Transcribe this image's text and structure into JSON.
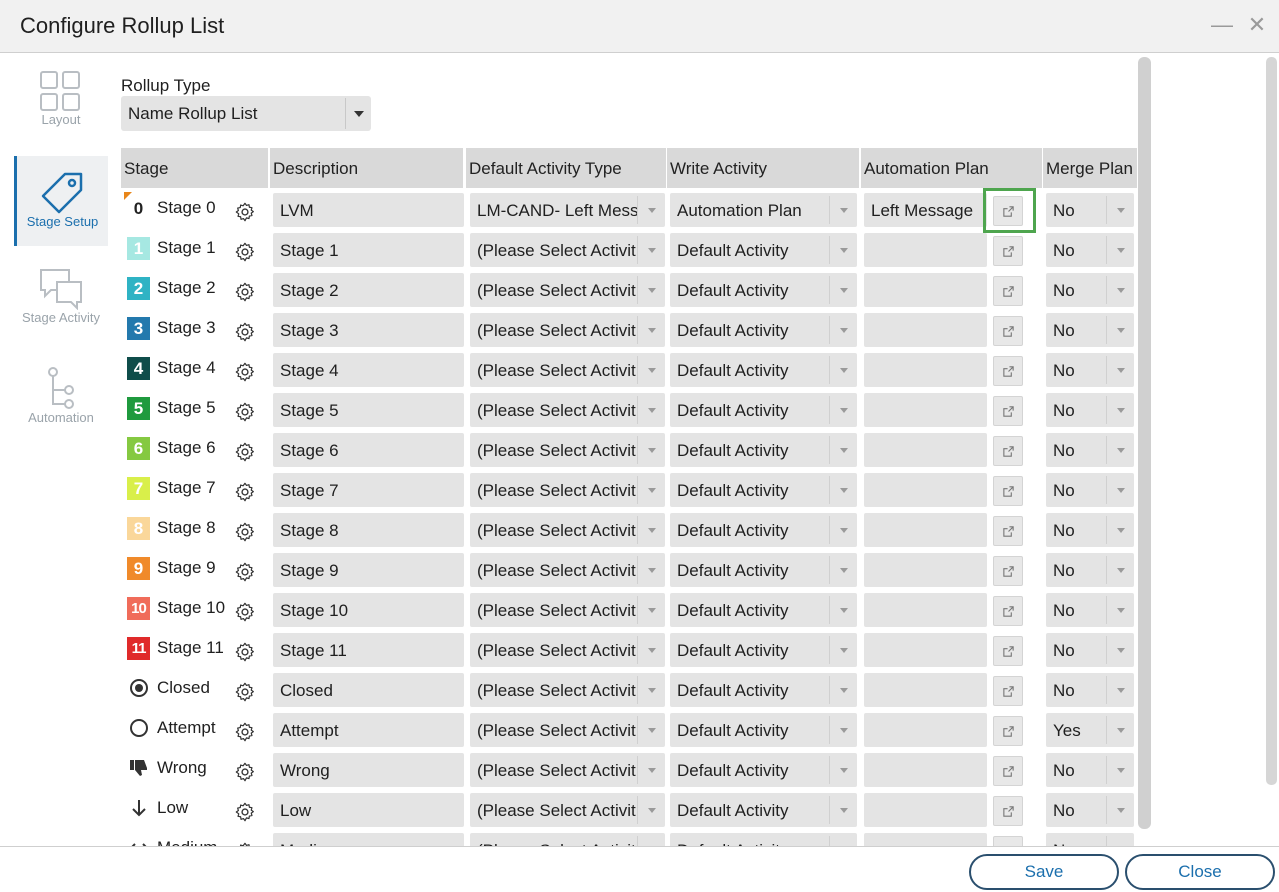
{
  "window": {
    "title": "Configure Rollup List",
    "minimize": "—",
    "close": "✕"
  },
  "sidenav": {
    "items": [
      {
        "label": "Layout",
        "icon": "layout-icon",
        "active": false
      },
      {
        "label": "Stage Setup",
        "icon": "tag-icon",
        "active": true
      },
      {
        "label": "Stage Activity",
        "icon": "chat-icon",
        "active": false
      },
      {
        "label": "Automation",
        "icon": "flow-icon",
        "active": false
      }
    ]
  },
  "rollup": {
    "label": "Rollup Type",
    "value": "Name Rollup List"
  },
  "columns": [
    "Stage",
    "Description",
    "Default Activity Type",
    "Write Activity",
    "Automation Plan",
    "Merge Plan"
  ],
  "rows": [
    {
      "badge": "0",
      "badge_color": "",
      "stage": "Stage 0",
      "description": "LVM",
      "activity_type": "LM-CAND- Left Mess",
      "write_activity": "Automation Plan",
      "automation_plan": "Left Message",
      "merge": "No"
    },
    {
      "badge": "1",
      "badge_color": "#a6e8e2",
      "stage": "Stage 1",
      "description": "Stage 1",
      "activity_type": "(Please Select Activit",
      "write_activity": "Default Activity",
      "automation_plan": "",
      "merge": "No"
    },
    {
      "badge": "2",
      "badge_color": "#2fb3c4",
      "stage": "Stage 2",
      "description": "Stage 2",
      "activity_type": "(Please Select Activit",
      "write_activity": "Default Activity",
      "automation_plan": "",
      "merge": "No"
    },
    {
      "badge": "3",
      "badge_color": "#2379ad",
      "stage": "Stage 3",
      "description": "Stage 3",
      "activity_type": "(Please Select Activit",
      "write_activity": "Default Activity",
      "automation_plan": "",
      "merge": "No"
    },
    {
      "badge": "4",
      "badge_color": "#0f4d4a",
      "stage": "Stage 4",
      "description": "Stage 4",
      "activity_type": "(Please Select Activit",
      "write_activity": "Default Activity",
      "automation_plan": "",
      "merge": "No"
    },
    {
      "badge": "5",
      "badge_color": "#1f9a3e",
      "stage": "Stage 5",
      "description": "Stage 5",
      "activity_type": "(Please Select Activit",
      "write_activity": "Default Activity",
      "automation_plan": "",
      "merge": "No"
    },
    {
      "badge": "6",
      "badge_color": "#85c941",
      "stage": "Stage 6",
      "description": "Stage 6",
      "activity_type": "(Please Select Activit",
      "write_activity": "Default Activity",
      "automation_plan": "",
      "merge": "No"
    },
    {
      "badge": "7",
      "badge_color": "#d9ef4a",
      "stage": "Stage 7",
      "description": "Stage 7",
      "activity_type": "(Please Select Activit",
      "write_activity": "Default Activity",
      "automation_plan": "",
      "merge": "No"
    },
    {
      "badge": "8",
      "badge_color": "#fad79a",
      "stage": "Stage 8",
      "description": "Stage 8",
      "activity_type": "(Please Select Activit",
      "write_activity": "Default Activity",
      "automation_plan": "",
      "merge": "No"
    },
    {
      "badge": "9",
      "badge_color": "#f08a2a",
      "stage": "Stage 9",
      "description": "Stage 9",
      "activity_type": "(Please Select Activit",
      "write_activity": "Default Activity",
      "automation_plan": "",
      "merge": "No"
    },
    {
      "badge": "10",
      "badge_color": "#f06c5a",
      "stage": "Stage 10",
      "description": "Stage 10",
      "activity_type": "(Please Select Activit",
      "write_activity": "Default Activity",
      "automation_plan": "",
      "merge": "No"
    },
    {
      "badge": "11",
      "badge_color": "#e02a2a",
      "stage": "Stage 11",
      "description": "Stage 11",
      "activity_type": "(Please Select Activit",
      "write_activity": "Default Activity",
      "automation_plan": "",
      "merge": "No"
    },
    {
      "badge": "closed-icon",
      "badge_color": "",
      "stage": "Closed",
      "description": "Closed",
      "activity_type": "(Please Select Activit",
      "write_activity": "Default Activity",
      "automation_plan": "",
      "merge": "No"
    },
    {
      "badge": "attempt-icon",
      "badge_color": "",
      "stage": "Attempt",
      "description": "Attempt",
      "activity_type": "(Please Select Activit",
      "write_activity": "Default Activity",
      "automation_plan": "",
      "merge": "Yes"
    },
    {
      "badge": "thumbs-down-icon",
      "badge_color": "",
      "stage": "Wrong",
      "description": "Wrong",
      "activity_type": "(Please Select Activit",
      "write_activity": "Default Activity",
      "automation_plan": "",
      "merge": "No"
    },
    {
      "badge": "arrow-down-icon",
      "badge_color": "",
      "stage": "Low",
      "description": "Low",
      "activity_type": "(Please Select Activit",
      "write_activity": "Default Activity",
      "automation_plan": "",
      "merge": "No"
    },
    {
      "badge": "arrows-horizontal-icon",
      "badge_color": "",
      "stage": "Medium",
      "description": "Medium",
      "activity_type": "(Please Select Activit",
      "write_activity": "Default Activity",
      "automation_plan": "",
      "merge": "No"
    }
  ],
  "footer": {
    "save": "Save",
    "close": "Close"
  }
}
